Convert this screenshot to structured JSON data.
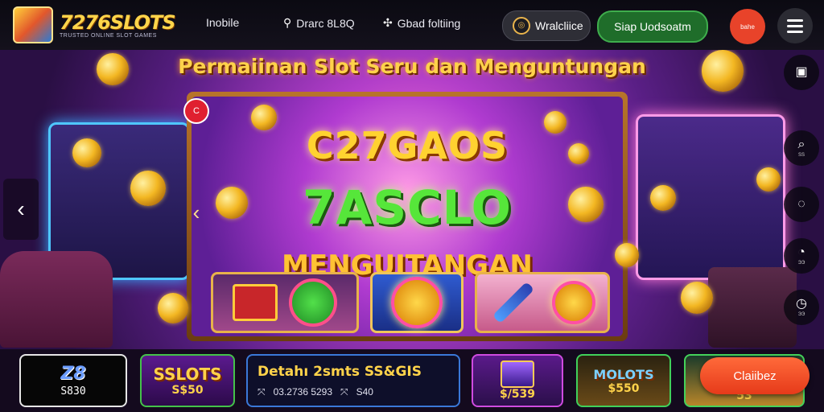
{
  "brand": {
    "name": "7276SLOTS",
    "tagline": "TRUSTED ONLINE SLOT GAMES"
  },
  "nav": {
    "items": [
      {
        "label": "Inobile",
        "icon": ""
      },
      {
        "label": "Drarc 8L8Q",
        "icon": "search-icon"
      },
      {
        "label": "Gbad foltiing",
        "icon": "dice-icon"
      }
    ]
  },
  "header_actions": {
    "wallet_label": "Wralcliice",
    "signup_label": "Siap Uodsoatm",
    "flag_label": "bahe"
  },
  "hero": {
    "title": "Permaiinan Slot Seru dan Menguntungan",
    "line1": "C27GAOS",
    "line2": "7ASCLO",
    "line3": "MENGUITANGAN",
    "badge": "C"
  },
  "sidebar_right": [
    {
      "name": "ticket",
      "symbol": "▣",
      "label": ""
    },
    {
      "name": "search",
      "symbol": "⌕",
      "label": "SS"
    },
    {
      "name": "spin",
      "symbol": "◌",
      "label": ""
    },
    {
      "name": "timer",
      "symbol": "◔",
      "label": "ЭЭ"
    },
    {
      "name": "history",
      "symbol": "◷",
      "label": "ЭЭ"
    }
  ],
  "strip": {
    "card1": {
      "logo": "Z8",
      "amount": "S830"
    },
    "card2": {
      "brand": "SSLOTS",
      "amount": "S$50"
    },
    "card3": {
      "title": "Detahı 2smts SS&GIS",
      "meta1": "03.2736 5293",
      "meta2": "S40"
    },
    "card4": {
      "amount": "$/539"
    },
    "card5": {
      "brand": "MOLOTS",
      "amount": "$550"
    },
    "card6": {
      "amount": "53"
    },
    "claim_label": "Claiibez"
  },
  "colors": {
    "accent_gold": "#ffd24a",
    "cta_orange": "#e63a1a",
    "signup_green": "#1f6d2a"
  }
}
